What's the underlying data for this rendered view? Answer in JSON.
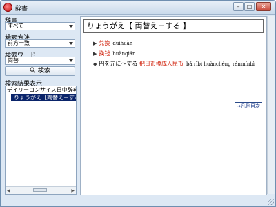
{
  "window": {
    "title": "辞書"
  },
  "left_panel": {
    "dictionary_label": "辞書",
    "dictionary_value": "すべて",
    "method_label": "検索方法",
    "method_value": "前方一致",
    "keyword_label": "検索ワード",
    "keyword_value": "両替",
    "search_button": "検索",
    "results_label": "検索結果表示",
    "results": [
      "デイリーコンサイス日中辞典 (1",
      "りょうがえ【両替え－する】"
    ]
  },
  "entry": {
    "headword": "りょうがえ【 両替え－する 】",
    "senses": [
      {
        "hanzi": "兑换",
        "pinyin": "duìhuàn"
      },
      {
        "hanzi": "换钱",
        "pinyin": "huànqián"
      }
    ],
    "example": {
      "jp": "円を元に～する",
      "zh": "把日币换成人民币",
      "pinyin": "bǎ rìbì huànchéng rénmínbì"
    },
    "hanrei_link": "→凡例目次"
  }
}
